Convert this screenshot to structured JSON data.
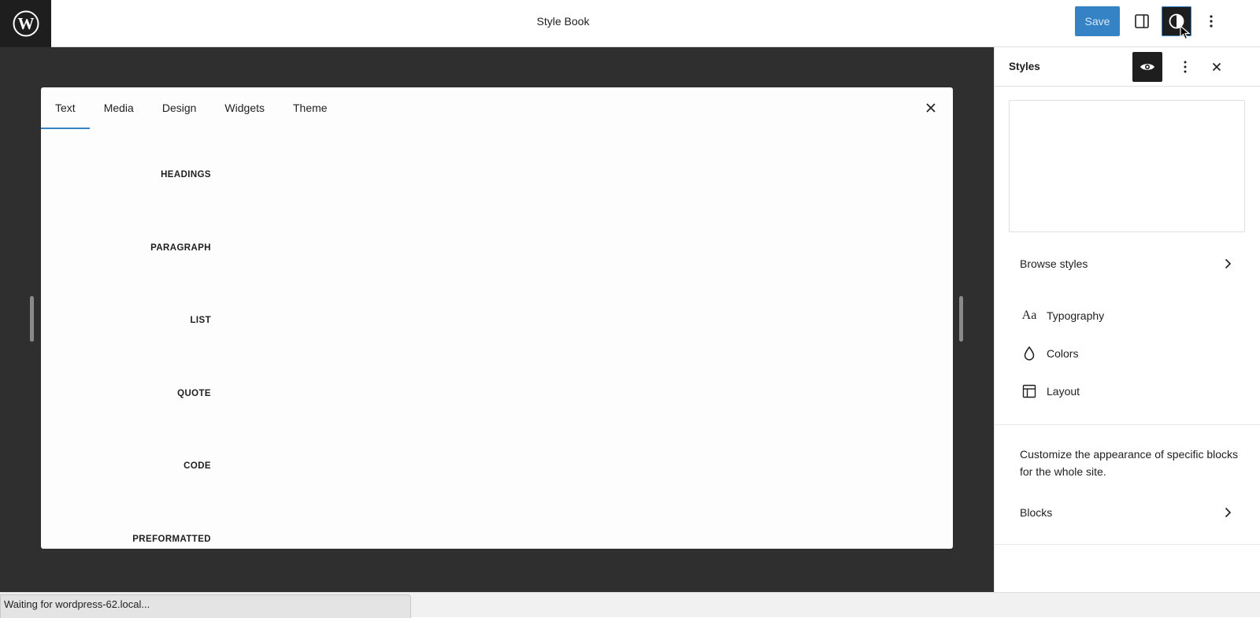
{
  "header": {
    "title": "Style Book",
    "save_label": "Save"
  },
  "stylebook": {
    "tabs": [
      "Text",
      "Media",
      "Design",
      "Widgets",
      "Theme"
    ],
    "active_tab": "Text",
    "sections": [
      "HEADINGS",
      "PARAGRAPH",
      "LIST",
      "QUOTE",
      "CODE",
      "PREFORMATTED"
    ]
  },
  "panel": {
    "title": "Styles",
    "browse_styles": "Browse styles",
    "nav": [
      {
        "icon": "typography-icon",
        "label": "Typography"
      },
      {
        "icon": "colors-droplet-icon",
        "label": "Colors"
      },
      {
        "icon": "layout-icon",
        "label": "Layout"
      }
    ],
    "blocks_description": "Customize the appearance of specific blocks for the whole site.",
    "blocks_label": "Blocks"
  },
  "status": {
    "text": "Waiting for wordpress-62.local..."
  },
  "colors": {
    "accent": "#3582c4",
    "dark": "#1e1e1e",
    "canvas_bg": "#2f2f2f"
  }
}
